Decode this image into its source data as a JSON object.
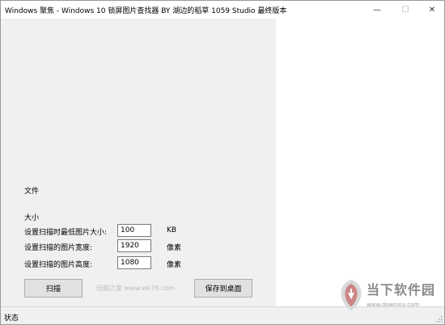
{
  "window": {
    "title": "Windows 聚焦 - Windows 10 锁屏图片查找器      BY 湖边的稻草 1059 Studio 最终版本",
    "minimize_glyph": "—",
    "maximize_glyph": "☐",
    "close_glyph": "✕"
  },
  "form": {
    "file_label": "文件",
    "size_label": "大小",
    "min_size": {
      "label": "设置扫描时最低图片大小:",
      "value": "100",
      "unit": "KB"
    },
    "width": {
      "label": "设置扫描的图片宽度:",
      "value": "1920",
      "unit": "像素"
    },
    "height": {
      "label": "设置扫描的图片高度:",
      "value": "1080",
      "unit": "像素"
    },
    "scan_button": "扫描",
    "save_button": "保存到桌面",
    "watermark": "玩脑之家 www.wk78.com"
  },
  "statusbar": {
    "text": "状态"
  },
  "brand_overlay": {
    "name": "当下软件园",
    "url": "www.downxia.com"
  }
}
